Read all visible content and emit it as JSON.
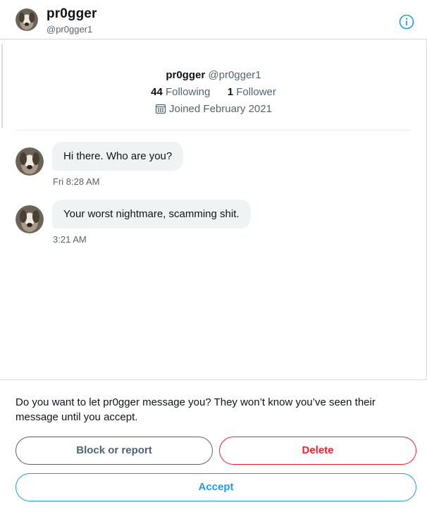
{
  "header": {
    "name": "pr0gger",
    "handle": "@pr0gger1",
    "info_icon": "info-icon"
  },
  "profile": {
    "name": "pr0gger",
    "handle": "@pr0gger1",
    "following_count": "44",
    "following_label": "Following",
    "followers_count": "1",
    "followers_label": "Follower",
    "joined": "Joined February 2021",
    "calendar_icon": "calendar-icon"
  },
  "messages": [
    {
      "text": "Hi there. Who are you?",
      "time": "Fri 8:28 AM"
    },
    {
      "text": "Your worst nightmare, scamming shit.",
      "time": "3:21 AM"
    }
  ],
  "request": {
    "prompt": "Do you want to let pr0gger message you? They won’t know you’ve seen their message until you accept.",
    "block_label": "Block or report",
    "delete_label": "Delete",
    "accept_label": "Accept"
  },
  "colors": {
    "accent": "#1d9bf0",
    "danger": "#f4212e",
    "bubble": "#eff3f4",
    "secondary_text": "#536471"
  }
}
